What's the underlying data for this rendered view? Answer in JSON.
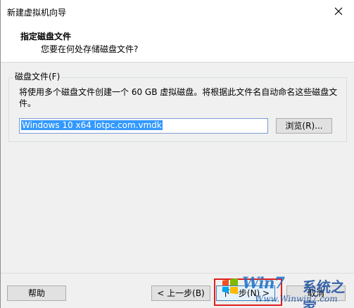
{
  "window": {
    "title": "新建虚拟机向导"
  },
  "header": {
    "title": "指定磁盘文件",
    "subtitle": "您要在何处存储磁盘文件?"
  },
  "group": {
    "legend": "磁盘文件(F)",
    "description": "将使用多个磁盘文件创建一个 60 GB 虚拟磁盘。将根据此文件名自动命名这些磁盘文件。",
    "filename": "Windows 10 x64 lotpc.com.vmdk",
    "browse_label": "浏览(R)..."
  },
  "footer": {
    "help_label": "帮助",
    "back_label": "< 上一步(B)",
    "next_label": "下一步(N) >",
    "cancel_label": "取消"
  },
  "watermark": {
    "brand": "Win7",
    "brand_cn": "系统之家",
    "url": "Www.Winwin7.com"
  },
  "colors": {
    "highlight": "#e01e1e",
    "selection": "#3399ff",
    "watermark_blue": "#1a6fc9"
  }
}
